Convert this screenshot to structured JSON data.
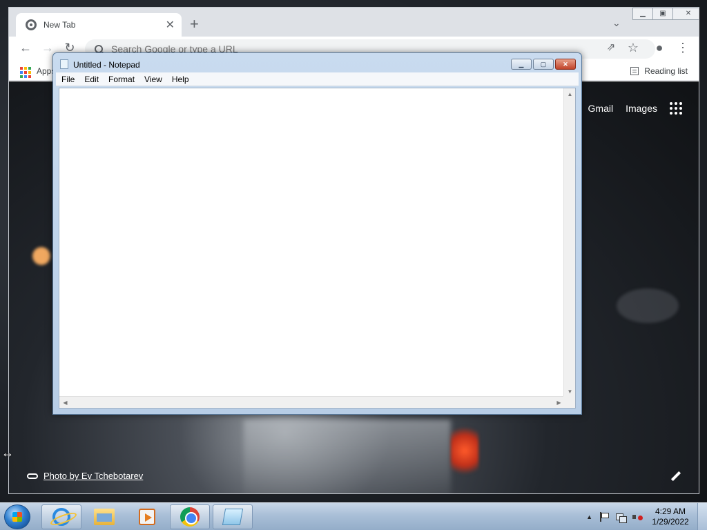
{
  "browser": {
    "tab_title": "New Tab",
    "omnibox_placeholder": "Search Google or type a URL",
    "bookmarks": {
      "apps_label": "Apps",
      "reading_list_label": "Reading list"
    },
    "ntp": {
      "gmail_label": "Gmail",
      "images_label": "Images",
      "attribution": "Photo by Ev Tchebotarev"
    },
    "icons": [
      "chrome-favicon-icon",
      "close-icon",
      "plus-icon",
      "tab-search-icon",
      "back-arrow-icon",
      "forward-arrow-icon",
      "reload-icon",
      "search-icon",
      "share-icon",
      "star-icon",
      "profile-icon",
      "more-menu-icon",
      "apps-grid-icon",
      "reading-list-icon",
      "google-apps-launcher-icon",
      "link-icon",
      "pencil-icon"
    ]
  },
  "notepad": {
    "title": "Untitled - Notepad",
    "menu": [
      "File",
      "Edit",
      "Format",
      "View",
      "Help"
    ],
    "content": ""
  },
  "taskbar": {
    "apps": [
      "Internet Explorer",
      "Windows Explorer",
      "Windows Media Player",
      "Google Chrome",
      "Notepad"
    ],
    "clock_time": "4:29 AM",
    "clock_date": "1/29/2022"
  },
  "colors": {
    "chrome_tabstrip": "#dee1e6",
    "notepad_frame": "#b7cde6",
    "taskbar": "#a9bfd7",
    "close_red": "#c1432a"
  }
}
